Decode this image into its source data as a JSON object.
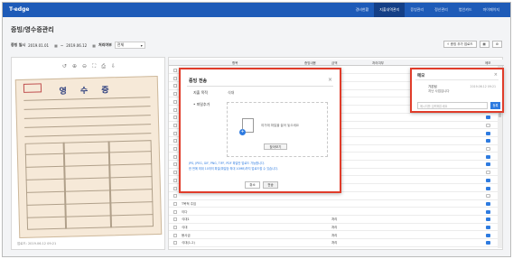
{
  "app": {
    "brand": "T-edge"
  },
  "nav": {
    "items": [
      "경비현황",
      "지출내역관리",
      "증빙관리",
      "정산관리",
      "법인카드",
      "마이페이지"
    ],
    "active": 1
  },
  "page": {
    "title": "증빙/영수증관리"
  },
  "filter": {
    "label_period": "증빙 일시",
    "date_from": "2019.01.01",
    "sep": "~",
    "date_to": "2019.06.12",
    "label_status": "처리여부",
    "status_value": "전체"
  },
  "tools": {
    "upload_label": "증빙 추가 업로드"
  },
  "viewer": {
    "timestamp": "업로드: 2019.06.12 09:21"
  },
  "table": {
    "headers": [
      "항목",
      "증빙내용",
      "금액",
      "처리여부",
      "메모"
    ],
    "rows": [
      {
        "item": "",
        "amount": "",
        "chat": false
      },
      {
        "item": "",
        "amount": "",
        "chat": false
      },
      {
        "item": "",
        "amount": "",
        "chat": true
      },
      {
        "item": "",
        "amount": "",
        "chat": true
      },
      {
        "item": "",
        "amount": "",
        "chat": false
      },
      {
        "item": "",
        "amount": "",
        "chat": true
      },
      {
        "item": "",
        "amount": "",
        "chat": true
      },
      {
        "item": "",
        "amount": "",
        "chat": false
      },
      {
        "item": "",
        "amount": "",
        "chat": true
      },
      {
        "item": "",
        "amount": "",
        "chat": true
      },
      {
        "item": "",
        "amount": "",
        "chat": false
      },
      {
        "item": "",
        "amount": "",
        "chat": true
      },
      {
        "item": "",
        "amount": "",
        "chat": true
      },
      {
        "item": "",
        "amount": "",
        "chat": false
      },
      {
        "item": "",
        "amount": "",
        "chat": true
      },
      {
        "item": "",
        "amount": "",
        "chat": true
      },
      {
        "item": "",
        "amount": "",
        "chat": false
      },
      {
        "item": "T목적 주임",
        "amount": "",
        "chat": true
      },
      {
        "item": "이다",
        "amount": "",
        "chat": true
      },
      {
        "item": "식대1",
        "amount": "처리",
        "chat": true
      },
      {
        "item": "식대",
        "amount": "처리",
        "chat": true
      },
      {
        "item": "봉사금",
        "amount": "처리",
        "chat": true
      },
      {
        "item": "식대(1-2)",
        "amount": "처리",
        "chat": true
      }
    ]
  },
  "upload_modal": {
    "title": "증빙 전송",
    "close": "×",
    "field_type_label": "지출 목적",
    "field_type_value": "식대",
    "field_file_label": "• 파일추가",
    "drop_text": "여기에 파일을 끌어 놓으세요",
    "browse": "찾아보기",
    "note1": "JPG, JPEG, GIF, PNG, TIFF, PDF 파일만 업로드 가능합니다.",
    "note2": "한 번에 최대 10개의 파일(파일당 최대 10MB)까지 업로드할 수 있습니다.",
    "cancel": "취소",
    "ok": "전송"
  },
  "memo_popup": {
    "title": "메모",
    "close": "×",
    "user": "가온팀",
    "message": "지난 사업입니다",
    "timestamp": "2019.06.12 09:21",
    "placeholder": "메시지를 입력해주세요",
    "submit": "등록"
  },
  "colors": {
    "topbar": "#1e5bb8",
    "accent": "#2e7be0",
    "highlight": "#e03c2a"
  }
}
